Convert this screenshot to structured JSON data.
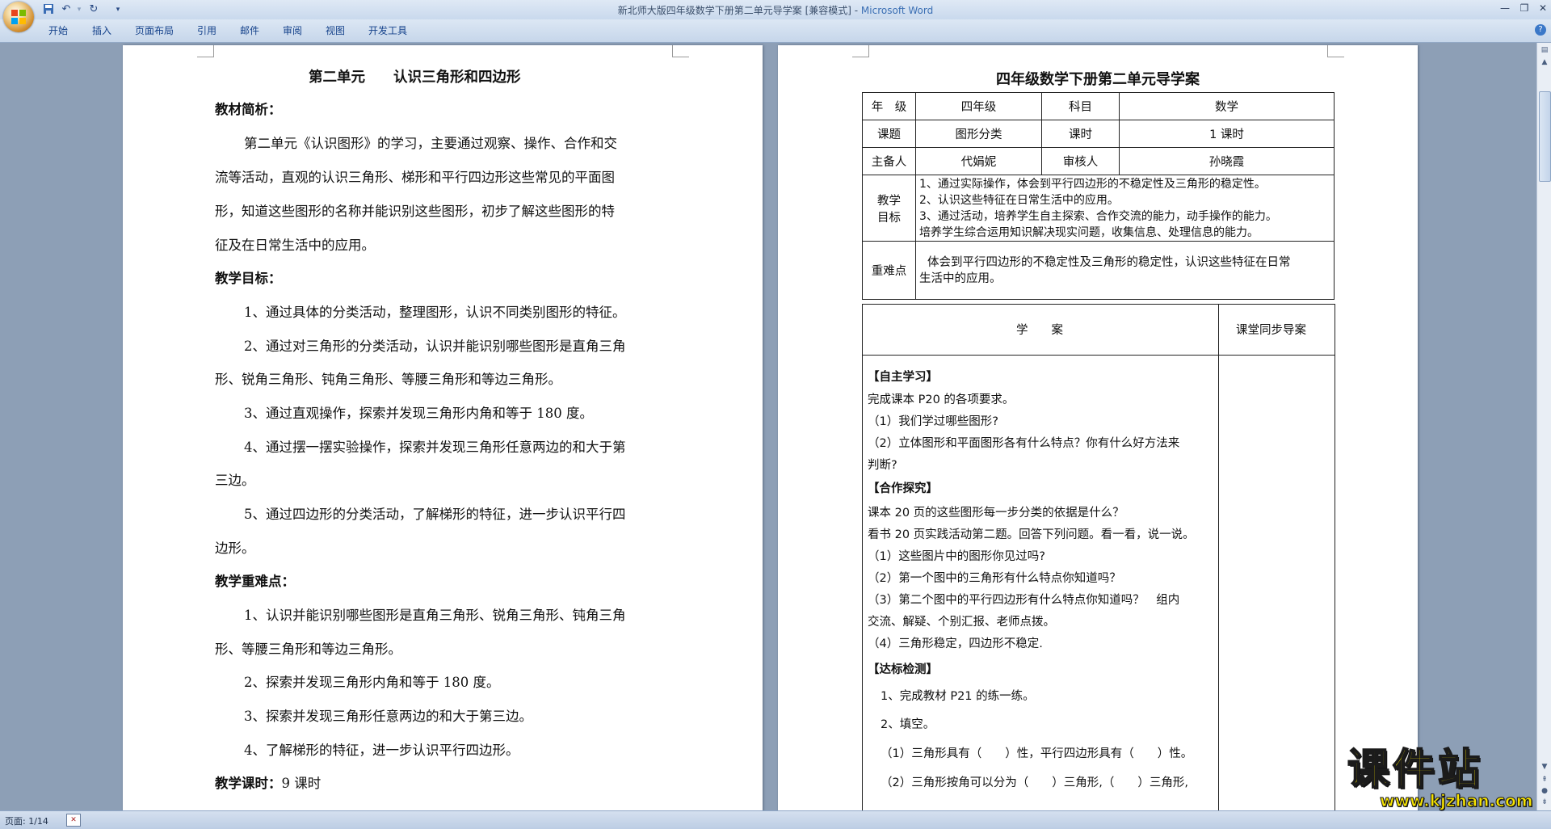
{
  "window": {
    "title": "新北师大版四年级数学下册第二单元导学案 [兼容模式] - ",
    "app_name": "Microsoft Word",
    "quick_access": [
      "save-icon",
      "undo-icon",
      "redo-icon",
      "customize-icon"
    ]
  },
  "ribbon": {
    "tabs": [
      "开始",
      "插入",
      "页面布局",
      "引用",
      "邮件",
      "审阅",
      "视图",
      "开发工具"
    ]
  },
  "left_page": {
    "title": "第二单元　　认识三角形和四边形",
    "h1": "教材简析：",
    "p1": [
      "第二单元《认识图形》的学习，主要通过观察、操作、合作和交",
      "流等活动，直观的认识三角形、梯形和平行四边形这些常见的平面图",
      "形，知道这些图形的名称并能识别这些图形，初步了解这些图形的特",
      "征及在日常生活中的应用。"
    ],
    "h2": "教学目标：",
    "goals": [
      "1、通过具体的分类活动，整理图形，认识不同类别图形的特征。",
      "2、通过对三角形的分类活动，认识并能识别哪些图形是直角三角",
      "形、锐角三角形、钝角三角形、等腰三角形和等边三角形。",
      "3、通过直观操作，探索并发现三角形内角和等于 180 度。",
      "4、通过摆一摆实验操作，探索并发现三角形任意两边的和大于第",
      "三边。",
      "5、通过四边形的分类活动，了解梯形的特征，进一步认识平行四",
      "边形。"
    ],
    "h3": "教学重难点：",
    "keys": [
      "1、认识并能识别哪些图形是直角三角形、锐角三角形、钝角三角",
      "形、等腰三角形和等边三角形。",
      "2、探索并发现三角形内角和等于 180 度。",
      "3、探索并发现三角形任意两边的和大于第三边。",
      "4、了解梯形的特征，进一步认识平行四边形。"
    ],
    "h4": "教学课时：",
    "hours": "9 课时"
  },
  "right_page": {
    "title": "四年级数学下册第二单元导学案",
    "table": {
      "grade_label": "年　级",
      "grade_value": "四年级",
      "subject_label": "科目",
      "subject_value": "数学",
      "topic_label": "课题",
      "topic_value": "图形分类",
      "hours_label": "课时",
      "hours_value": "1 课时",
      "preparer_label": "主备人",
      "preparer_value": "代娟妮",
      "reviewer_label": "审核人",
      "reviewer_value": "孙晓霞",
      "goals_label_1": "教学",
      "goals_label_2": "目标",
      "goals": [
        "1、通过实际操作，体会到平行四边形的不稳定性及三角形的稳定性。",
        "2、认识这些特征在日常生活中的应用。",
        "3、通过活动，培养学生自主探索、合作交流的能力，动手操作的能力。",
        "培养学生综合运用知识解决现实问题，收集信息、处理信息的能力。"
      ],
      "key_label": "重难点",
      "key_text_1": "体会到平行四边形的不稳定性及三角形的稳定性，认识这些特征在日常",
      "key_text_2": "生活中的应用。"
    },
    "guide": {
      "col_a": "学　　案",
      "col_b": "课堂同步导案",
      "s1": "【自主学习】",
      "s1_lines": [
        "完成课本 P20 的各项要求。",
        "（1）我们学过哪些图形?",
        "（2）立体图形和平面图形各有什么特点？你有什么好方法来",
        "判断?"
      ],
      "s2": "【合作探究】",
      "s2_lines": [
        "课本 20 页的这些图形每一步分类的依据是什么？",
        "看书 20 页实践活动第二题。回答下列问题。看一看，说一说。",
        "（1）这些图片中的图形你见过吗?",
        "（2）第一个图中的三角形有什么特点你知道吗？",
        "（3）第二个图中的平行四边形有什么特点你知道吗？　组内",
        "交流、解疑、个别汇报、老师点拨。",
        "（4）三角形稳定，四边形不稳定."
      ],
      "s3": "【达标检测】",
      "s3_lines": [
        "1、完成教材 P21 的练一练。",
        "2、填空。",
        "（1）三角形具有（　　）性，平行四边形具有（　　）性。",
        "（2）三角形按角可以分为（　　）三角形,（　　）三角形,"
      ]
    }
  },
  "status": {
    "page": "页面: 1/14"
  },
  "watermark": {
    "text": "课件站",
    "url": "www.kjzhan.com"
  }
}
